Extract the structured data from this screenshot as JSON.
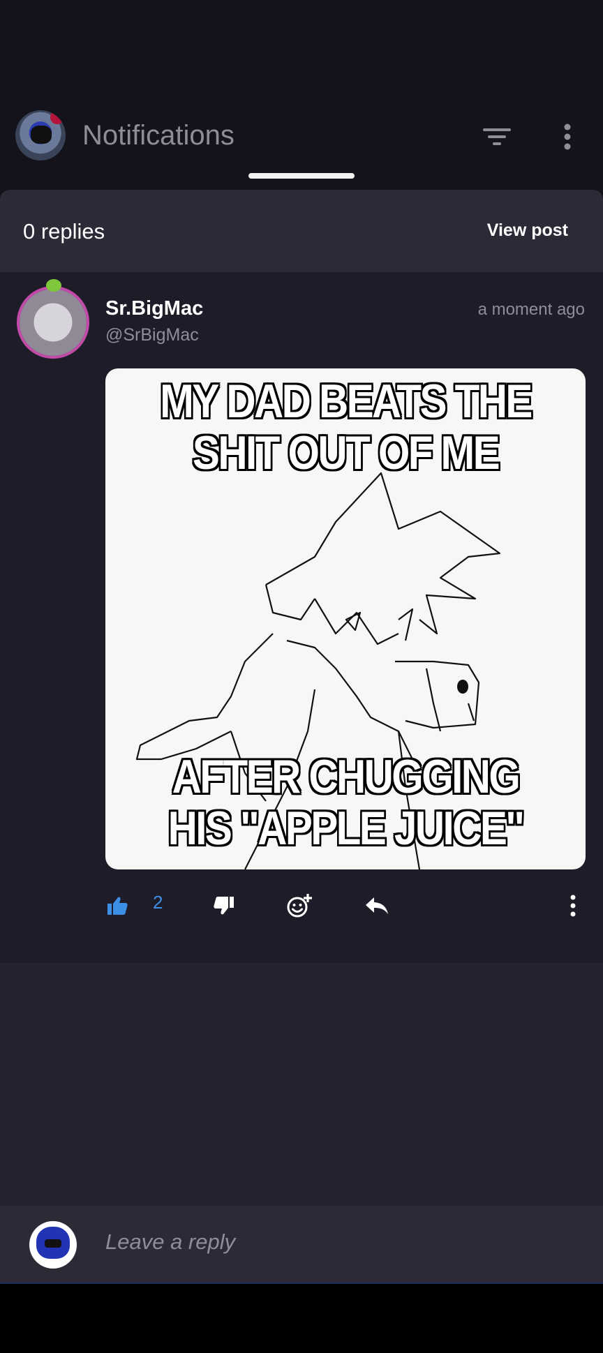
{
  "header": {
    "title": "Notifications"
  },
  "sheet": {
    "replies_label": "0 replies",
    "view_post_label": "View post"
  },
  "post": {
    "author": "Sr.BigMac",
    "handle": "@SrBigMac",
    "time": "a moment ago",
    "meme": {
      "top_caption": "MY DAD BEATS THE SHIT OUT OF ME",
      "bottom_caption": "AFTER CHUGGING HIS \"APPLE JUICE\""
    },
    "like_count": "2"
  },
  "reply_bar": {
    "placeholder": "Leave a reply"
  },
  "colors": {
    "background": "#14131c",
    "sheet": "#25232f",
    "post": "#1d1c28",
    "accent": "#3d8fe6",
    "muted_text": "#8f8e98"
  },
  "icons": {
    "filter": "filter-icon",
    "more": "more-vertical-icon",
    "like": "thumb-up-icon",
    "dislike": "thumb-down-icon",
    "react": "add-reaction-icon",
    "reply": "reply-icon"
  }
}
